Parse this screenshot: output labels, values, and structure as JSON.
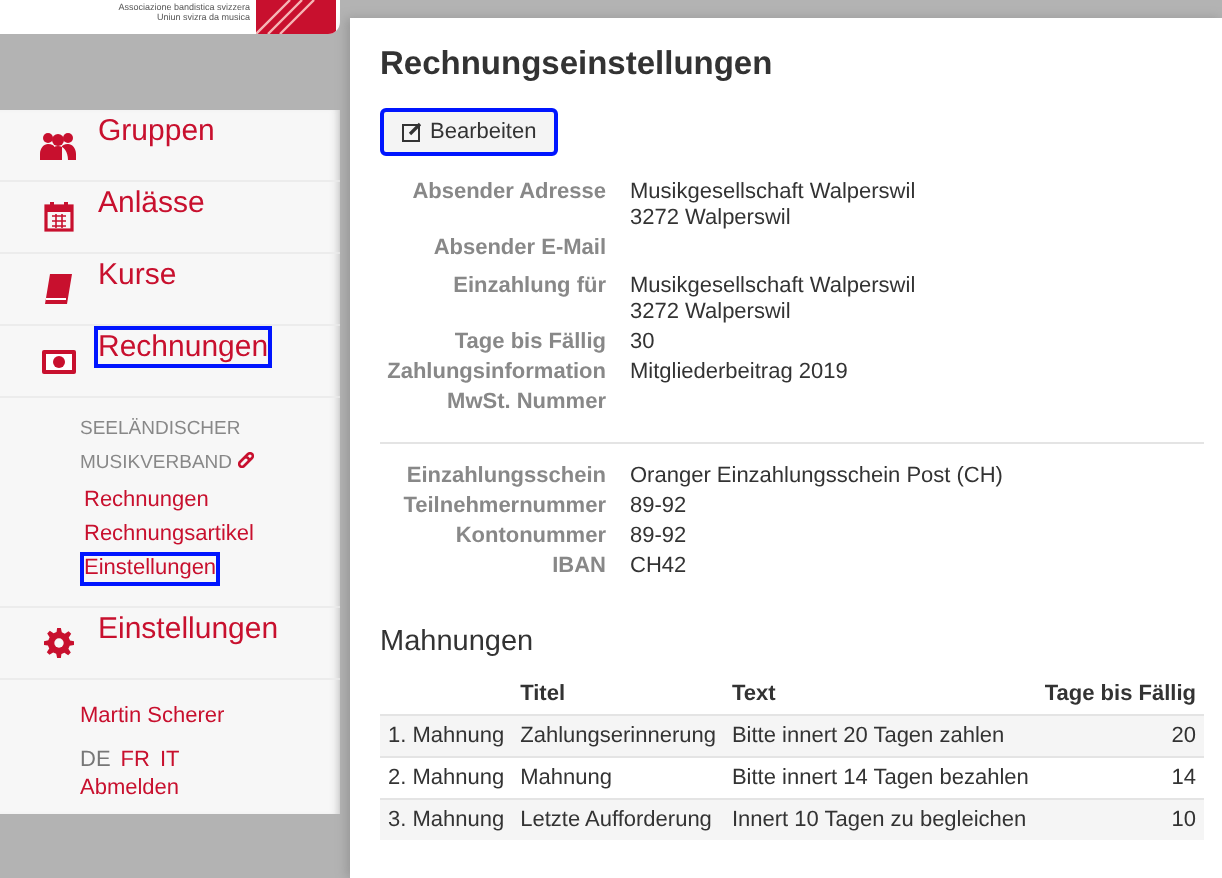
{
  "logo": {
    "lines": [
      "Associazione bandistica svizzera",
      "Uniun svizra da musica"
    ]
  },
  "sidebar": {
    "items": [
      {
        "kind": "nav",
        "label": "Gruppen",
        "highlighted": false
      },
      {
        "kind": "nav",
        "label": "Anlässe",
        "highlighted": false
      },
      {
        "kind": "nav",
        "label": "Kurse",
        "highlighted": false
      },
      {
        "kind": "nav",
        "label": "Rechnungen",
        "highlighted": true,
        "submenu": {
          "group": "SEELÄNDISCHER MUSIKVERBAND",
          "links": [
            {
              "label": "Rechnungen",
              "highlighted": false
            },
            {
              "label": "Rechnungsartikel",
              "highlighted": false
            },
            {
              "label": "Einstellungen",
              "highlighted": true
            }
          ]
        }
      },
      {
        "kind": "nav",
        "label": "Einstellungen",
        "highlighted": false
      }
    ],
    "user": "Martin Scherer",
    "languages": [
      {
        "label": "DE",
        "selected": true
      },
      {
        "label": "FR",
        "selected": false
      },
      {
        "label": "IT",
        "selected": false
      }
    ],
    "logout": "Abmelden"
  },
  "main": {
    "title": "Rechnungseinstellungen",
    "edit_button": {
      "label": "Bearbeiten",
      "highlighted": true
    },
    "sections": [
      [
        {
          "label": "Absender Adresse",
          "value": [
            "Musikgesellschaft Walperswil",
            "3272 Walperswil"
          ]
        },
        {
          "label": "Absender E-Mail"
        },
        {
          "label": "Einzahlung für",
          "value": [
            "Musikgesellschaft Walperswil",
            "3272 Walperswil"
          ]
        },
        {
          "label": "Tage bis Fällig",
          "value": [
            "30"
          ]
        },
        {
          "label": "Zahlungsinformation",
          "value": [
            "Mitgliederbeitrag 2019"
          ]
        },
        {
          "label": "MwSt. Nummer"
        }
      ],
      [
        {
          "label": "Einzahlungsschein",
          "value": [
            "Oranger Einzahlungsschein Post (CH)"
          ]
        },
        {
          "label": "Teilnehmernummer",
          "value": [
            "89-92"
          ]
        },
        {
          "label": "Kontonummer",
          "value": [
            "89-92"
          ]
        },
        {
          "label": "IBAN",
          "value": [
            "CH42"
          ]
        }
      ]
    ],
    "reminders": {
      "title": "Mahnungen",
      "columns": [
        "",
        "Titel",
        "Text",
        "Tage bis Fällig"
      ],
      "rows": [
        [
          "1. Mahnung",
          "Zahlungserinnerung",
          "Bitte innert 20 Tagen zahlen",
          "20"
        ],
        [
          "2. Mahnung",
          "Mahnung",
          "Bitte innert 14 Tagen bezahlen",
          "14"
        ],
        [
          "3. Mahnung",
          "Letzte Aufforderung",
          "Innert 10 Tagen zu begleichen",
          "10"
        ]
      ]
    }
  }
}
